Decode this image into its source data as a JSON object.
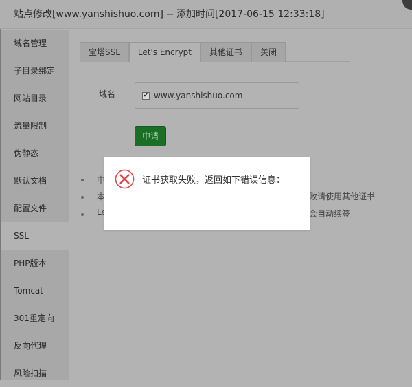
{
  "title": "站点修改[www.yanshishuo.com] -- 添加时间[2017-06-15 12:33:18]",
  "sidebar": {
    "items": [
      {
        "label": "域名管理"
      },
      {
        "label": "子目录绑定"
      },
      {
        "label": "网站目录"
      },
      {
        "label": "流量限制"
      },
      {
        "label": "伪静态"
      },
      {
        "label": "默认文档"
      },
      {
        "label": "配置文件"
      },
      {
        "label": "SSL",
        "active": true
      },
      {
        "label": "PHP版本"
      },
      {
        "label": "Tomcat"
      },
      {
        "label": "301重定向"
      },
      {
        "label": "反向代理"
      },
      {
        "label": "风险扫描"
      }
    ]
  },
  "tabs": [
    {
      "label": "宝塔SSL"
    },
    {
      "label": "Let's Encrypt",
      "active": true
    },
    {
      "label": "其他证书"
    },
    {
      "label": "关闭"
    }
  ],
  "form": {
    "domain_label": "域名",
    "domain_value": "www.yanshishuo.com",
    "domain_checked": true,
    "apply_label": "申请",
    "apply_color": "#1a6e26"
  },
  "notes": [
    {
      "left": "申",
      "right": ""
    },
    {
      "left": "本",
      "right": "败请使用其他证书"
    },
    {
      "left": "Le",
      "right": "会自动续签"
    }
  ],
  "dialog": {
    "icon": "error-x-circle-icon",
    "message": "证书获取失败，返回如下错误信息：",
    "icon_color": "#e0474c"
  }
}
